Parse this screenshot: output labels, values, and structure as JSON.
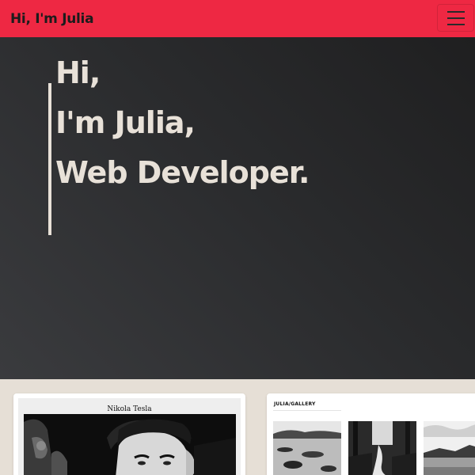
{
  "navbar": {
    "brand": "Hi, I'm Julia",
    "toggle_icon": "hamburger-menu-icon",
    "background": "#ee2843"
  },
  "hero": {
    "lines": [
      "Hi,",
      "I'm Julia,",
      "Web Developer."
    ],
    "text_color": "#e8e1d8"
  },
  "cards": {
    "tesla": {
      "title": "Nikola Tesla",
      "image": "black-and-white portrait photo"
    },
    "gallery": {
      "title": "JULIA/GALLERY",
      "thumbnails": [
        "lake-landscape",
        "forest-stream",
        "mountain-lake"
      ]
    }
  }
}
